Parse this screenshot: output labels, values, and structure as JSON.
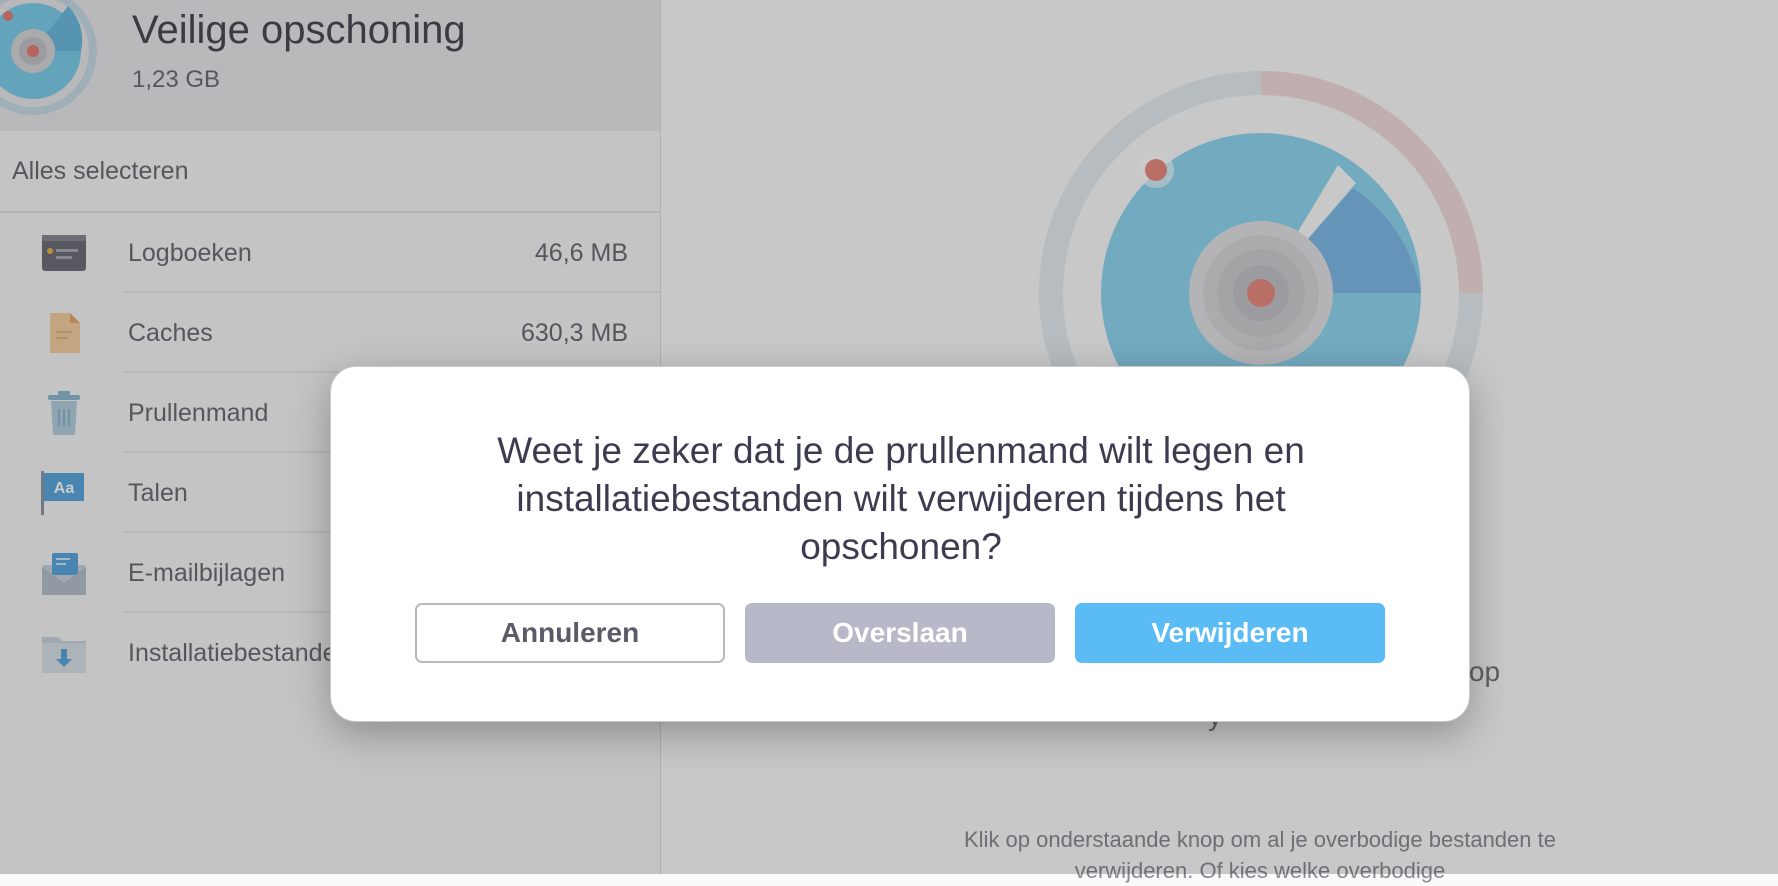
{
  "header": {
    "title": "Veilige opschoning",
    "size": "1,23 GB",
    "icon": "radar-icon"
  },
  "sidebar": {
    "select_all": "Alles selecteren",
    "items": [
      {
        "label": "Logboeken",
        "size": "46,6 MB",
        "icon": "log-icon"
      },
      {
        "label": "Caches",
        "size": "630,3 MB",
        "icon": "document-icon"
      },
      {
        "label": "Prullenmand",
        "size": "",
        "icon": "trash-icon"
      },
      {
        "label": "Talen",
        "size": "",
        "icon": "language-flag-icon"
      },
      {
        "label": "E-mailbijlagen",
        "size": "",
        "icon": "mail-icon"
      },
      {
        "label": "Installatiebestanden",
        "size": "",
        "icon": "download-folder-icon"
      }
    ]
  },
  "main": {
    "partial_text_1": "en op",
    "partial_text_2": "y",
    "description": "Klik op onderstaande knop om al je overbodige bestanden te verwijderen. Of kies welke overbodige"
  },
  "dialog": {
    "message": "Weet je zeker dat je de prullenmand wilt legen en installatiebestanden wilt verwijderen tijdens het opschonen?",
    "cancel_label": "Annuleren",
    "skip_label": "Overslaan",
    "delete_label": "Verwijderen"
  },
  "colors": {
    "accent": "#5bbcf5",
    "skip_button": "#b7b9c9",
    "radar_blue": "#7fd0ee"
  }
}
